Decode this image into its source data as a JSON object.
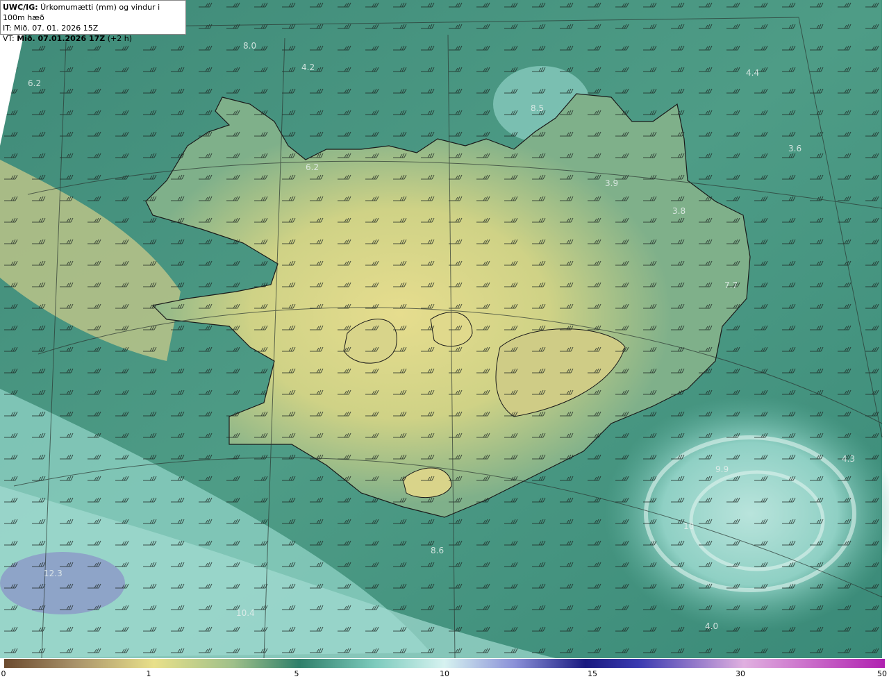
{
  "header": {
    "title_bold": "UWC/IG:",
    "title_rest": " Úrkomumætti (mm) og vindur i 100m hæð",
    "issue_time": "IT: Mið. 07. 01. 2026 15Z",
    "valid_prefix": "VT: ",
    "valid_time": "Mið. 07.01.2026 17Z",
    "valid_suffix": " (+2 h)"
  },
  "map_labels": [
    "8.0",
    "4.2",
    "6.2",
    "4.4",
    "8.5",
    "6.2",
    "3.9",
    "3.6",
    "3.8",
    "7.7",
    "4.3",
    "9.9",
    "10",
    "8.6",
    "12.3",
    "10.4",
    "4.0"
  ],
  "colorbar": {
    "ticks": [
      "0",
      "1",
      "5",
      "10",
      "15",
      "30",
      "50"
    ],
    "colors": [
      "#6b4a2e",
      "#c9b98a",
      "#e8e08a",
      "#2f7f6a",
      "#9fdad0",
      "#cfeef0",
      "#4a4ab0",
      "#1a1a80",
      "#2a2aa0",
      "#d8a0d8",
      "#b020b0"
    ]
  }
}
